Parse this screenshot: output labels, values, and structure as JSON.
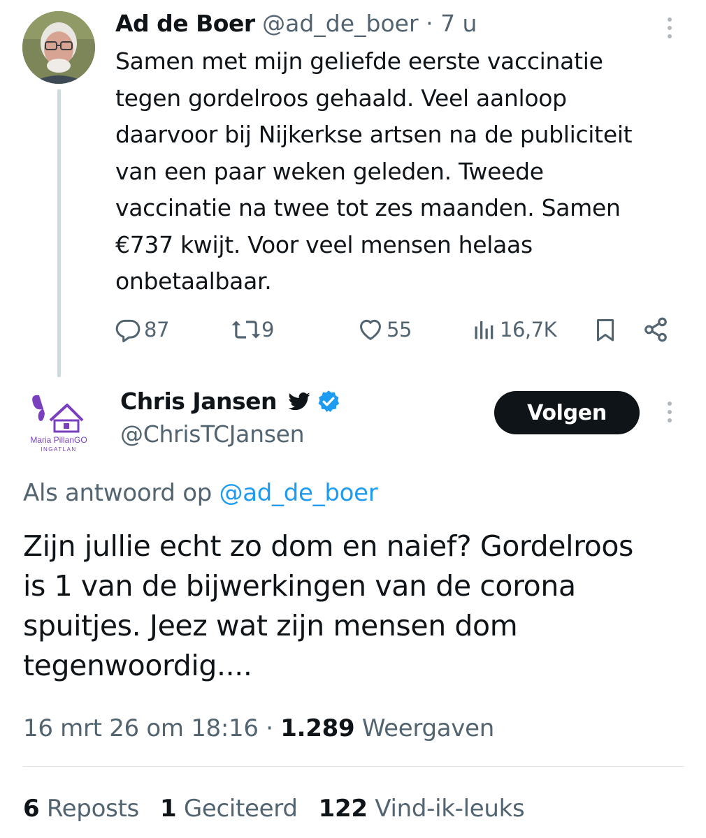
{
  "tweet1": {
    "name": "Ad de Boer",
    "handle": "@ad_de_boer",
    "time": "7 u",
    "text": "Samen met mijn geliefde eerste vaccinatie\ntegen gordelroos gehaald. Veel aanloop\ndaarvoor bij Nijkerkse artsen na de publiciteit\nvan een paar weken geleden. Tweede\nvaccinatie na twee tot zes maanden. Samen\n€737 kwijt. Voor veel mensen helaas\nonbetaalbaar.",
    "replies": "87",
    "reposts": "9",
    "likes": "55",
    "views": "16,7K"
  },
  "tweet2": {
    "name": "Chris Jansen",
    "handle": "@ChrisTCJansen",
    "avatar_text_line1": "Maria PillanGO",
    "avatar_text_line2": "INGATLAN",
    "follow_label": "Volgen",
    "reply_prefix": "Als antwoord op",
    "reply_mention": "@ad_de_boer",
    "text": "Zijn jullie echt zo dom en naief? Gordelroos\nis 1 van de bijwerkingen van de corona\nspuitjes. Jeez wat zijn mensen dom\ntegenwoordig....",
    "date": "16 mrt 26 om 18:16",
    "views_count": "1.289",
    "views_label": "Weergaven",
    "reposts_count": "6",
    "reposts_label": "Reposts",
    "quotes_count": "1",
    "quotes_label": "Geciteerd",
    "likes_count": "122",
    "likes_label": "Vind-ik-leuks"
  },
  "colors": {
    "text": "#0f1419",
    "secondary": "#536471",
    "accent": "#1d9bf0",
    "verified": "#1d9bf0",
    "avatar_purple": "#7a3fbf"
  }
}
